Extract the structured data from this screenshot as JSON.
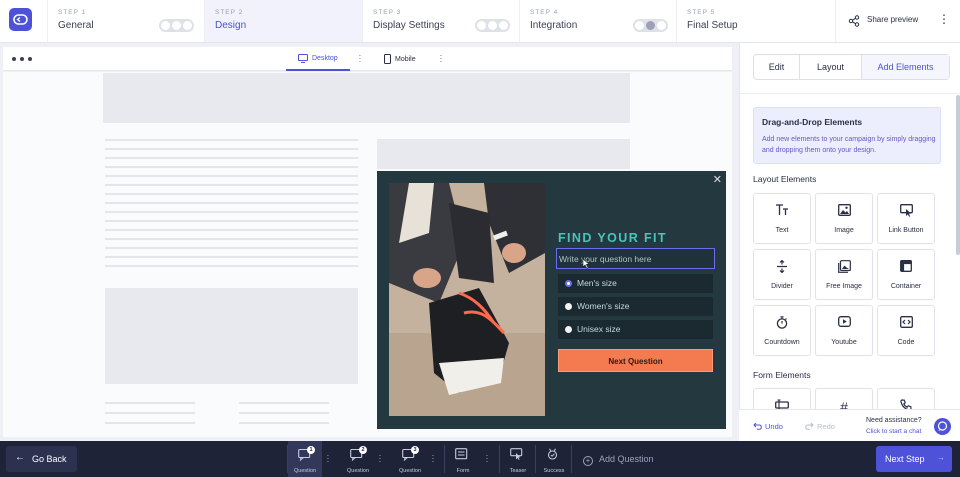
{
  "stepper": {
    "steps": [
      {
        "num": "STEP 1",
        "label": "General"
      },
      {
        "num": "STEP 2",
        "label": "Design"
      },
      {
        "num": "STEP 3",
        "label": "Display Settings"
      },
      {
        "num": "STEP 4",
        "label": "Integration"
      },
      {
        "num": "STEP 5",
        "label": "Final Setup"
      }
    ],
    "active_step": "Design",
    "share_label": "Share preview"
  },
  "canvas": {
    "devices": [
      {
        "label": "Desktop",
        "active": true
      },
      {
        "label": "Mobile",
        "active": false
      }
    ]
  },
  "popup": {
    "title": "FIND YOUR FIT",
    "question_placeholder": "Write your question here",
    "options": [
      "Men's size",
      "Women's size",
      "Unisex size"
    ],
    "selected_option": "Men's size",
    "button_label": "Next Question",
    "close_glyph": "✕"
  },
  "right_panel": {
    "tabs": [
      "Edit",
      "Layout",
      "Add Elements"
    ],
    "active_tab": "Add Elements",
    "info": {
      "heading": "Drag-and-Drop Elements",
      "description": "Add new elements to your campaign by simply dragging and dropping them onto your design."
    },
    "layout_section": "Layout Elements",
    "layout_elements": [
      {
        "label": "Text",
        "icon": "text-icon"
      },
      {
        "label": "Image",
        "icon": "image-icon"
      },
      {
        "label": "Link Button",
        "icon": "link-button-icon"
      },
      {
        "label": "Divider",
        "icon": "divider-icon"
      },
      {
        "label": "Free Image",
        "icon": "free-image-icon"
      },
      {
        "label": "Container",
        "icon": "container-icon"
      },
      {
        "label": "Countdown",
        "icon": "stopwatch-icon"
      },
      {
        "label": "Youtube",
        "icon": "youtube-icon"
      },
      {
        "label": "Code",
        "icon": "code-icon"
      }
    ],
    "form_section": "Form Elements",
    "form_elements": [
      {
        "label": "",
        "icon": "input-icon"
      },
      {
        "label": "",
        "icon": "hash-icon"
      },
      {
        "label": "",
        "icon": "phone-icon"
      }
    ],
    "undo_label": "Undo",
    "redo_label": "Redo",
    "assist_title": "Need assistance?",
    "assist_link": "Click to start a chat"
  },
  "bottom_bar": {
    "go_back_label": "Go Back",
    "steps": [
      {
        "label": "Question",
        "badge": "1",
        "active": true
      },
      {
        "label": "Question",
        "badge": "2",
        "active": false
      },
      {
        "label": "Question",
        "badge": "3",
        "active": false
      },
      {
        "label": "Form",
        "badge": "",
        "active": false
      },
      {
        "label": "Teaser",
        "badge": "",
        "active": false
      },
      {
        "label": "Success",
        "badge": "",
        "active": false
      }
    ],
    "add_question_label": "Add Question",
    "next_step_label": "Next Step"
  },
  "colors": {
    "accent": "#4d52d8",
    "popup_bg": "#243840",
    "popup_title": "#46c6b9",
    "popup_button": "#f47a50",
    "bottom_bar": "#1f2338"
  }
}
